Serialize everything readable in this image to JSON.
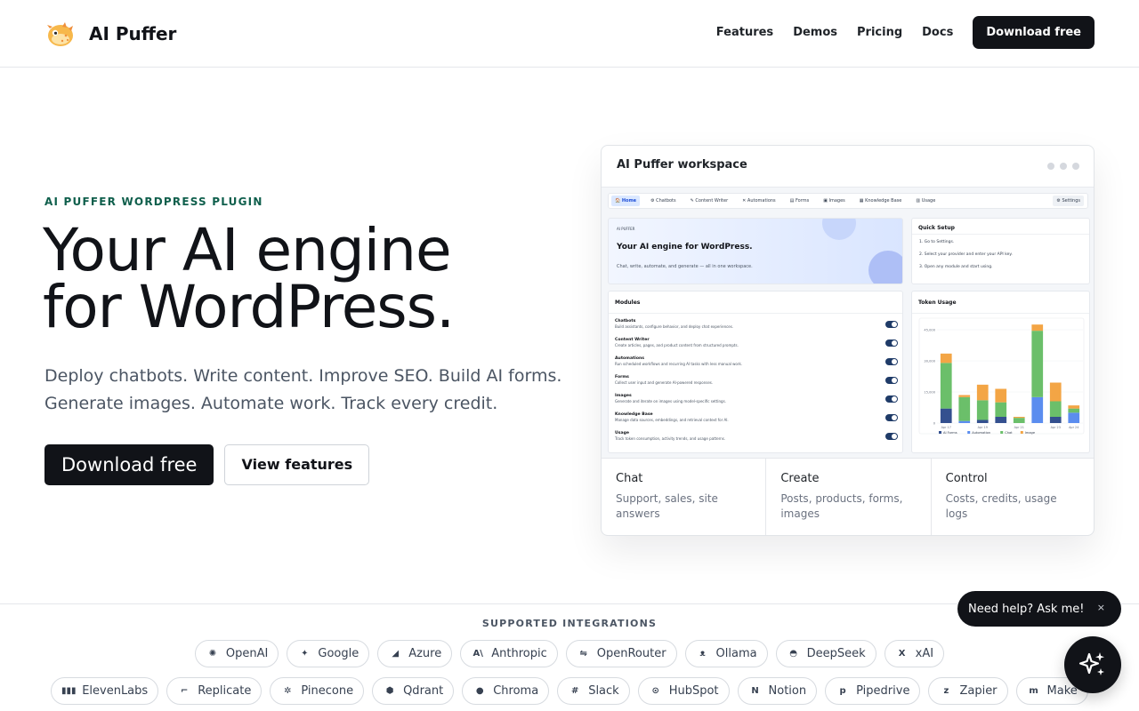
{
  "header": {
    "brand": "AI Puffer",
    "nav": [
      "Features",
      "Demos",
      "Pricing",
      "Docs"
    ],
    "cta": "Download free"
  },
  "hero": {
    "eyebrow": "AI PUFFER WORDPRESS PLUGIN",
    "title_line1": "Your AI engine",
    "title_line2": "for WordPress.",
    "subtitle": "Deploy chatbots. Write content. Improve SEO. Build AI forms. Generate images. Automate work. Track every credit.",
    "primary_cta": "Download free",
    "secondary_cta": "View features"
  },
  "workspace": {
    "title": "AI Puffer workspace",
    "preview": {
      "nav": [
        "Home",
        "Chatbots",
        "Content Writer",
        "Automations",
        "Forms",
        "Images",
        "Knowledge Base",
        "Usage"
      ],
      "settings": "Settings",
      "hero_label": "AI PUFFER",
      "hero_title": "Your AI engine for WordPress.",
      "hero_sub": "Chat, write, automate, and generate — all in one workspace.",
      "quick_title": "Quick Setup",
      "quick_steps": [
        "1. Go to Settings.",
        "2. Select your provider and enter your API key.",
        "3. Open any module and start using."
      ],
      "modules_title": "Modules",
      "modules": [
        {
          "name": "Chatbots",
          "desc": "Build assistants, configure behavior, and deploy chat experiences."
        },
        {
          "name": "Content Writer",
          "desc": "Create articles, pages, and product content from structured prompts."
        },
        {
          "name": "Automations",
          "desc": "Run scheduled workflows and recurring AI tasks with less manual work."
        },
        {
          "name": "Forms",
          "desc": "Collect user input and generate AI-powered responses."
        },
        {
          "name": "Images",
          "desc": "Generate and iterate on images using model-specific settings."
        },
        {
          "name": "Knowledge Base",
          "desc": "Manage data sources, embeddings, and retrieval context for AI."
        },
        {
          "name": "Usage",
          "desc": "Track token consumption, activity trends, and usage patterns."
        }
      ],
      "usage_title": "Token Usage"
    },
    "footer": [
      {
        "title": "Chat",
        "desc": "Support, sales, site answers"
      },
      {
        "title": "Create",
        "desc": "Posts, products, forms, images"
      },
      {
        "title": "Control",
        "desc": "Costs, credits, usage logs"
      }
    ]
  },
  "chart_data": {
    "type": "bar",
    "title": "Token Usage",
    "stacked": true,
    "categories": [
      "Apr 17",
      "Apr 18",
      "Apr 19",
      "Apr 20",
      "Apr 21",
      "Apr 22",
      "Apr 23",
      "Apr 24"
    ],
    "x_tick_labels": [
      "Apr 17",
      "Apr 19",
      "Apr 21",
      "Apr 23",
      "Apr 24"
    ],
    "y_tick_labels": [
      "0",
      "15,000",
      "30,000",
      "45,000"
    ],
    "ylim": [
      0,
      48000
    ],
    "series": [
      {
        "name": "AI Forms",
        "color": "#34508f",
        "values": [
          7000,
          0,
          1500,
          3000,
          0,
          0,
          3000,
          0
        ]
      },
      {
        "name": "Automation",
        "color": "#5b8def",
        "values": [
          0,
          1000,
          0,
          0,
          0,
          12500,
          0,
          5000
        ]
      },
      {
        "name": "Chat",
        "color": "#6bbf6a",
        "values": [
          22000,
          11500,
          9500,
          7000,
          2500,
          32000,
          7500,
          2000
        ]
      },
      {
        "name": "Image",
        "color": "#f3a545",
        "values": [
          4500,
          1000,
          7500,
          6500,
          500,
          3000,
          9000,
          1500
        ]
      }
    ],
    "legend": "bottom"
  },
  "integrations": {
    "title": "SUPPORTED INTEGRATIONS",
    "row1": [
      {
        "label": "OpenAI",
        "icon": "openai-icon",
        "glyph": "✺"
      },
      {
        "label": "Google",
        "icon": "google-icon",
        "glyph": "✦"
      },
      {
        "label": "Azure",
        "icon": "azure-icon",
        "glyph": "◢"
      },
      {
        "label": "Anthropic",
        "icon": "anthropic-icon",
        "glyph": "A\\"
      },
      {
        "label": "OpenRouter",
        "icon": "openrouter-icon",
        "glyph": "⇋"
      },
      {
        "label": "Ollama",
        "icon": "ollama-icon",
        "glyph": "ᴥ"
      },
      {
        "label": "DeepSeek",
        "icon": "deepseek-icon",
        "glyph": "◓"
      },
      {
        "label": "xAI",
        "icon": "xai-icon",
        "glyph": "X"
      }
    ],
    "row2": [
      {
        "label": "ElevenLabs",
        "icon": "elevenlabs-icon",
        "glyph": "▮▮▮"
      },
      {
        "label": "Replicate",
        "icon": "replicate-icon",
        "glyph": "⌐"
      },
      {
        "label": "Pinecone",
        "icon": "pinecone-icon",
        "glyph": "✲"
      },
      {
        "label": "Qdrant",
        "icon": "qdrant-icon",
        "glyph": "⬢"
      },
      {
        "label": "Chroma",
        "icon": "chroma-icon",
        "glyph": "●"
      },
      {
        "label": "Slack",
        "icon": "slack-icon",
        "glyph": "#"
      },
      {
        "label": "HubSpot",
        "icon": "hubspot-icon",
        "glyph": "⊙"
      },
      {
        "label": "Notion",
        "icon": "notion-icon",
        "glyph": "N"
      },
      {
        "label": "Pipedrive",
        "icon": "pipedrive-icon",
        "glyph": "p"
      },
      {
        "label": "Zapier",
        "icon": "zapier-icon",
        "glyph": "z"
      },
      {
        "label": "Make",
        "icon": "make-icon",
        "glyph": "m"
      }
    ]
  },
  "help": {
    "bubble": "Need help? Ask me!",
    "close": "×"
  },
  "colors": {
    "brand_dark": "#111318",
    "eyebrow_green": "#0f5f4c",
    "muted_text": "#4b5563"
  }
}
